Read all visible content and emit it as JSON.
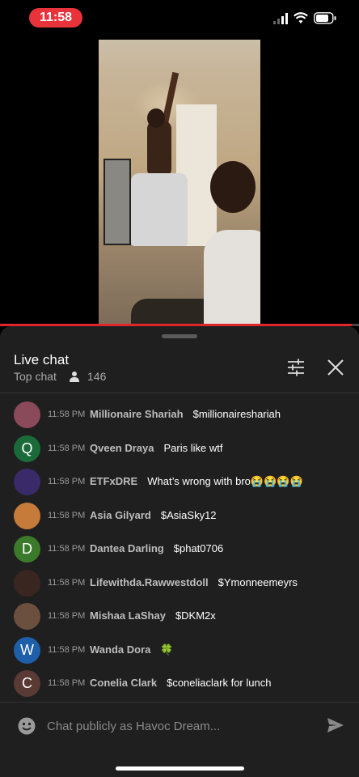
{
  "status_bar": {
    "time": "11:58"
  },
  "colors": {
    "accent": "#e0252b",
    "time_pill": "#e8333b",
    "panel": "#1f1f1f"
  },
  "video": {
    "progress": 0.98
  },
  "chat": {
    "title": "Live chat",
    "mode": "Top chat",
    "viewer_count": "146",
    "input_placeholder": "Chat publicly as Havoc Dream...",
    "messages": [
      {
        "time": "11:58 PM",
        "author": "Millionaire Shariah",
        "text": "$millionaireshariah",
        "avatar_letter": "",
        "avatar_color": "#8a4a5a"
      },
      {
        "time": "11:58 PM",
        "author": "Qveen Draya",
        "text": "Paris like wtf",
        "avatar_letter": "Q",
        "avatar_color": "#1b6b3a"
      },
      {
        "time": "11:58 PM",
        "author": "ETFxDRE",
        "text": "What’s wrong with bro😭😭😭😭",
        "avatar_letter": "",
        "avatar_color": "#3a2a6a"
      },
      {
        "time": "11:58 PM",
        "author": "Asia Gilyard",
        "text": "$AsiaSky12",
        "avatar_letter": "",
        "avatar_color": "#c77b3a"
      },
      {
        "time": "11:58 PM",
        "author": "Dantea Darling",
        "text": "$phat0706",
        "avatar_letter": "D",
        "avatar_color": "#3b7a2a"
      },
      {
        "time": "11:58 PM",
        "author": "Lifewithda.Rawwestdoll",
        "text": "$Ymonneemeyrs",
        "avatar_letter": "",
        "avatar_color": "#3a2620"
      },
      {
        "time": "11:58 PM",
        "author": "Mishaa LaShay",
        "text": "$DKM2x",
        "avatar_letter": "",
        "avatar_color": "#6b5040"
      },
      {
        "time": "11:58 PM",
        "author": "Wanda Dora",
        "text": "🍀",
        "avatar_letter": "W",
        "avatar_color": "#1d5fa8"
      },
      {
        "time": "11:58 PM",
        "author": "Conelia Clark",
        "text": "$coneliaclark for lunch",
        "avatar_letter": "C",
        "avatar_color": "#5a3a34"
      }
    ]
  }
}
